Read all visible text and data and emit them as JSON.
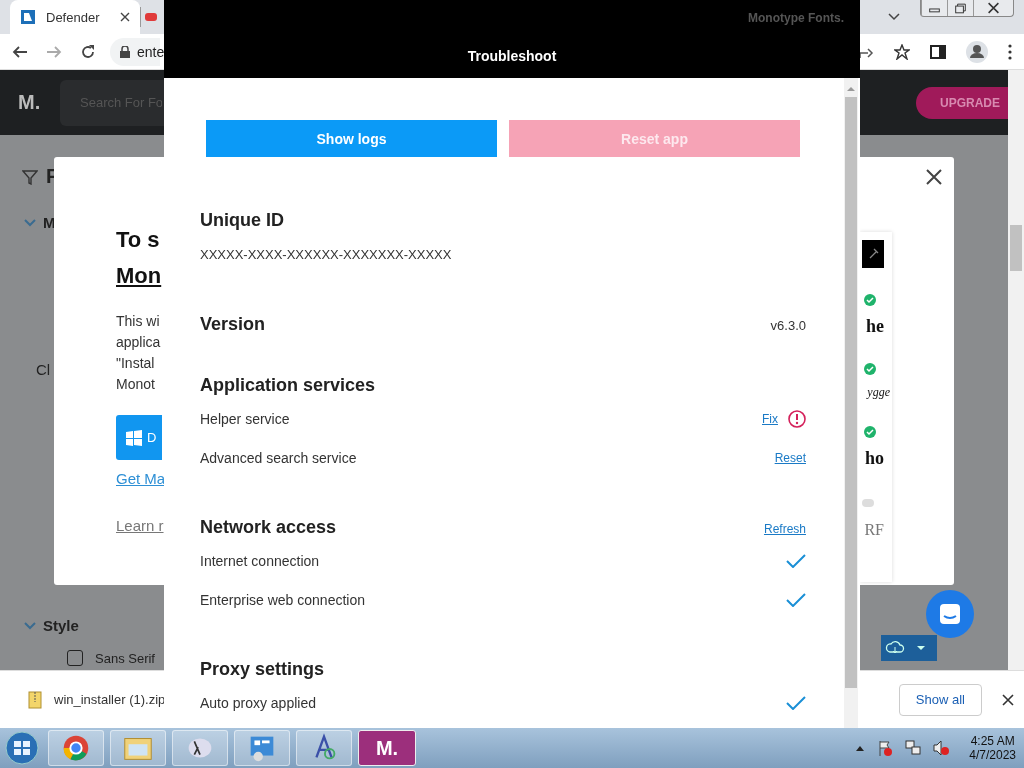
{
  "browser": {
    "tabs": [
      {
        "title": "Defender",
        "selected": true
      },
      {
        "selected": false
      }
    ],
    "address": "ente"
  },
  "site": {
    "logo": "M.",
    "search_placeholder": "Search For Fo",
    "upgrade": "UPGRADE"
  },
  "page": {
    "filter_label": "F",
    "groups": [
      {
        "title": "M",
        "expanded": true
      },
      {
        "title": "Style",
        "expanded": true
      }
    ],
    "option": "Cl",
    "checkbox": {
      "label": "Sans Serif",
      "checked": false
    }
  },
  "modal": {
    "heading": "To s",
    "heading_link": "Mon",
    "paragraph": [
      "This wi",
      "applica",
      "\"Instal",
      "Monot"
    ],
    "button": "D",
    "link": "Get Ma",
    "secondary_link": "Learn r",
    "previews": [
      {
        "sample": "he",
        "kind": "bold"
      },
      {
        "sample": "ygge",
        "kind": "italic"
      },
      {
        "sample": "ho",
        "kind": "bold"
      }
    ],
    "last_sample": "RF"
  },
  "troubleshoot": {
    "brand": "Monotype Fonts.",
    "title": "Troubleshoot",
    "buttons": [
      {
        "label": "Show logs",
        "disabled": false
      },
      {
        "label": "Reset app",
        "disabled": true
      }
    ],
    "unique_id": {
      "heading": "Unique ID",
      "value": "XXXXX-XXXX-XXXXXX-XXXXXXX-XXXXX"
    },
    "version": {
      "heading": "Version",
      "value": "v6.3.0"
    },
    "sections": [
      {
        "title": "Application services",
        "rows": [
          {
            "label": "Helper service",
            "action": "Fix",
            "kind": "warning"
          },
          {
            "label": "Advanced search service",
            "action": "Reset",
            "kind": "plain"
          }
        ]
      },
      {
        "title": "Network access",
        "action": "Refresh",
        "rows": [
          {
            "label": "Internet connection",
            "kind": "ok"
          },
          {
            "label": "Enterprise web connection",
            "kind": "ok"
          }
        ]
      },
      {
        "title": "Proxy settings",
        "rows": [
          {
            "label": "Auto proxy applied",
            "kind": "ok"
          }
        ]
      }
    ]
  },
  "downloads": {
    "file": "win_installer (1).zip",
    "show_all": "Show all"
  },
  "taskbar": {
    "app_label": "M.",
    "time": "4:25 AM",
    "date": "4/7/2023"
  }
}
